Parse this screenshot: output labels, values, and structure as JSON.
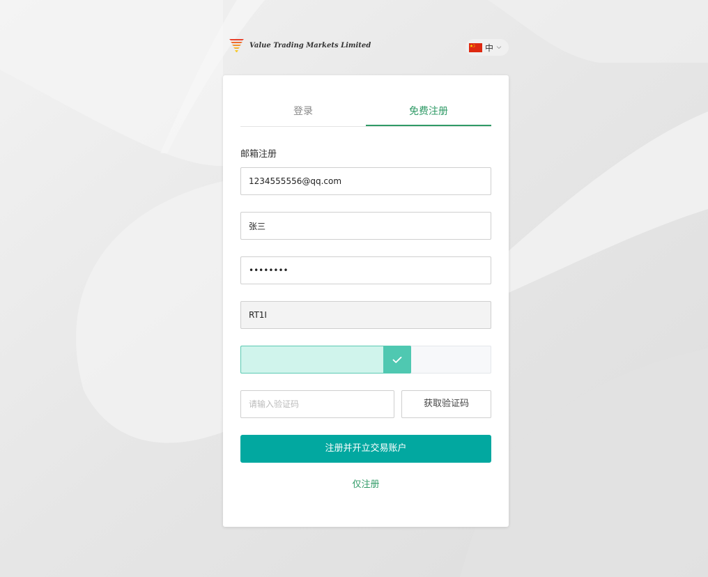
{
  "header": {
    "logo_text": "Value Trading Markets Limited",
    "language_label": "中"
  },
  "tabs": [
    {
      "label": "登录",
      "active": false
    },
    {
      "label": "免费注册",
      "active": true
    }
  ],
  "form": {
    "section_label": "邮箱注册",
    "email_value": "1234555556@qq.com",
    "name_value": "张三",
    "password_value": "12345678",
    "captcha_value": "RT1I",
    "slider_progress": 0.68,
    "code_placeholder": "请输入验证码",
    "get_code_label": "获取验证码",
    "submit_label": "注册并开立交易账户",
    "only_register_label": "仅注册"
  },
  "colors": {
    "accent": "#2f9a66",
    "button": "#02a8a0",
    "slider_handle": "#4fc8b1",
    "slider_fill": "#d0f4ec"
  }
}
